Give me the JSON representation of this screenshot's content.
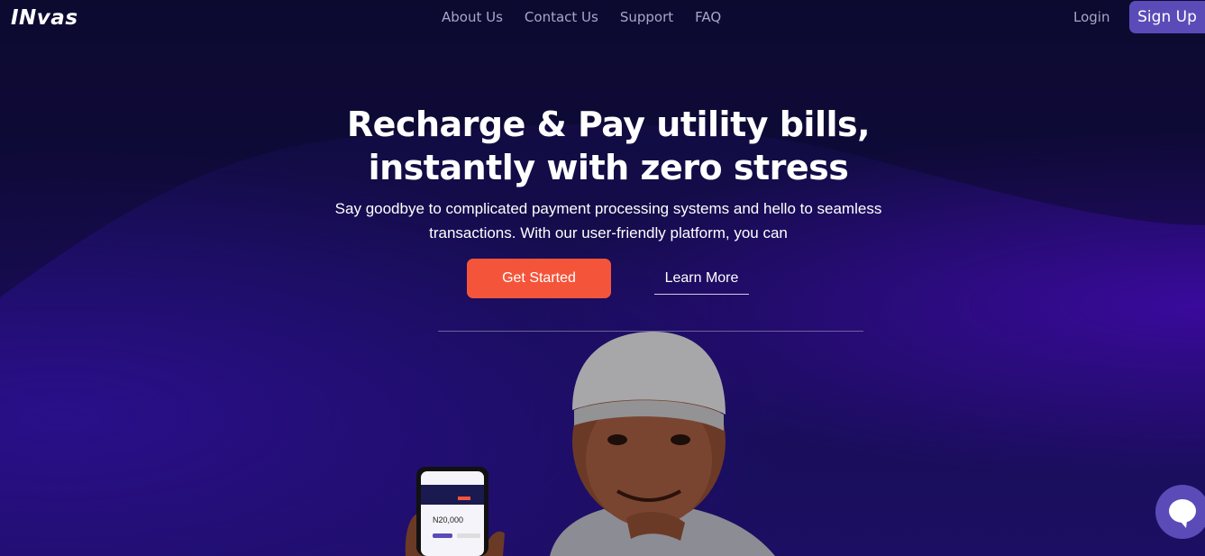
{
  "brand": {
    "logo_text": "INvas"
  },
  "nav": {
    "links": [
      "About Us",
      "Contact Us",
      "Support",
      "FAQ"
    ],
    "login_label": "Login",
    "signup_label": "Sign Up"
  },
  "hero": {
    "title": "Recharge & Pay utility bills, instantly with zero stress",
    "subtitle": "Say goodbye to complicated payment processing systems and hello to seamless transactions. With our user-friendly platform, you can",
    "primary_cta": "Get Started",
    "secondary_cta": "Learn More"
  },
  "phone": {
    "balance": "N20,000"
  },
  "icons": {
    "chat": "chat-bubble-icon"
  },
  "colors": {
    "accent": "#f4553a",
    "brand_purple": "#5a4bb8"
  }
}
